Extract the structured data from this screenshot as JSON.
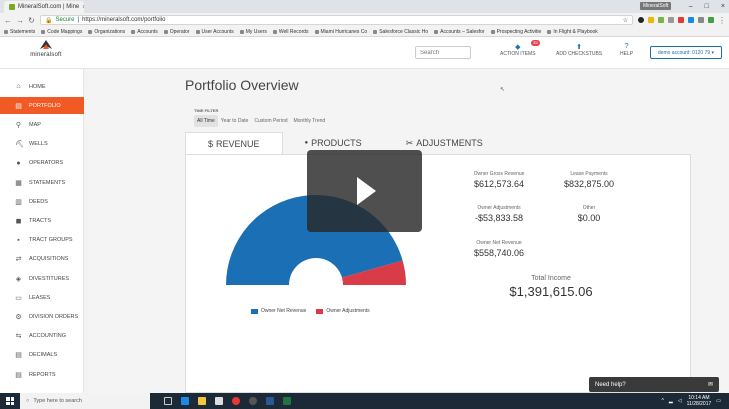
{
  "browser": {
    "tab_title": "MineralSoft.com | Mine",
    "tab_close": "×",
    "user_badge": "MineralSoft",
    "secure_label": "Secure",
    "url": "https://mineralsoft.com/portfolio",
    "bookmarks": [
      "Statements",
      "Code Mappings",
      "Organizations",
      "Accounts",
      "Operator",
      "User Accounts",
      "My Users",
      "Well Records",
      "Miami Hurricanes Co",
      "Salesforce Classic Ho",
      "Accounts – Salesfor",
      "Prospecting Activitie",
      "In Flight & Playbook"
    ]
  },
  "header": {
    "logo_text": "mineralsoft",
    "search_placeholder": "Search",
    "action_items_label": "ACTION ITEMS",
    "action_items_badge": "35",
    "add_checkstubs_label": "ADD CHECKSTUBS",
    "help_label": "HELP",
    "account_label": "demo account: 0120 79 ▾"
  },
  "sidebar": {
    "items": [
      {
        "label": "HOME",
        "icon": "home-icon"
      },
      {
        "label": "PORTFOLIO",
        "icon": "portfolio-icon"
      },
      {
        "label": "MAP",
        "icon": "map-pin-icon"
      },
      {
        "label": "WELLS",
        "icon": "oil-pump-icon"
      },
      {
        "label": "OPERATORS",
        "icon": "person-icon"
      },
      {
        "label": "STATEMENTS",
        "icon": "document-icon"
      },
      {
        "label": "DEEDS",
        "icon": "deed-icon"
      },
      {
        "label": "TRACTS",
        "icon": "tract-icon"
      },
      {
        "label": "TRACT GROUPS",
        "icon": "tract-groups-icon"
      },
      {
        "label": "ACQUISITIONS",
        "icon": "acquisitions-icon"
      },
      {
        "label": "DIVESTITURES",
        "icon": "divestitures-icon"
      },
      {
        "label": "LEASES",
        "icon": "lease-icon"
      },
      {
        "label": "DIVISION ORDERS",
        "icon": "division-orders-icon"
      },
      {
        "label": "ACCOUNTING",
        "icon": "accounting-icon"
      },
      {
        "label": "DECIMALS",
        "icon": "decimals-icon"
      },
      {
        "label": "REPORTS",
        "icon": "reports-icon"
      }
    ],
    "active_index": 1
  },
  "main": {
    "page_title": "Portfolio Overview",
    "time_filter_label": "TIME FILTER",
    "time_filters": [
      "All Time",
      "Year to Date",
      "Custom Period",
      "Monthly Trend"
    ],
    "active_time_filter": 0,
    "tabs": [
      {
        "label": "REVENUE",
        "icon": "$"
      },
      {
        "label": "PRODUCTS",
        "icon": "droplet-icon"
      },
      {
        "label": "ADJUSTMENTS",
        "icon": "scissors-icon"
      }
    ],
    "active_tab": 0,
    "stats": {
      "owner_gross_revenue_label": "Owner Gross Revenue",
      "owner_gross_revenue": "$612,573.64",
      "lease_payments_label": "Lease Payments",
      "lease_payments": "$832,875.00",
      "owner_adjustments_label": "Owner Adjustments",
      "owner_adjustments": "-$53,833.58",
      "other_label": "Other",
      "other": "$0.00",
      "owner_net_revenue_label": "Owner Net Revenue",
      "owner_net_revenue": "$558,740.06",
      "total_income_label": "Total Income",
      "total_income": "$1,391,615.06"
    },
    "legend": [
      "Owner Net Revenue",
      "Owner Adjustments"
    ],
    "help_widget_label": "Need help?"
  },
  "chart_data": {
    "type": "pie",
    "variant": "half-donut",
    "categories": [
      "Owner Net Revenue",
      "Owner Adjustments"
    ],
    "values": [
      558740.06,
      53833.58
    ],
    "colors": [
      "#1a6fb5",
      "#d93b48"
    ]
  },
  "taskbar": {
    "search_placeholder": "Type here to search",
    "time": "10:14 AM",
    "date": "11/28/2017"
  },
  "colors": {
    "accent": "#f15a24",
    "primary": "#1a6fb5",
    "negative": "#d93b48"
  }
}
